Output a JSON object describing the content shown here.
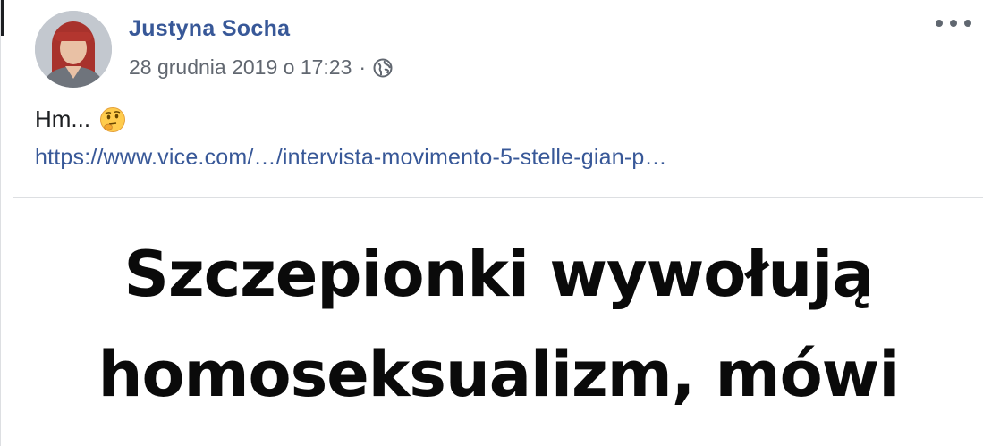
{
  "post": {
    "author": "Justyna Socha",
    "timestamp": "28 grudnia 2019 o 17:23",
    "separator": "·",
    "privacy_icon": "globe-icon",
    "more_icon": "more-options-icon",
    "text": "Hm...",
    "emoji": "thinking-face-emoji",
    "link_text": "https://www.vice.com/…/intervista-movimento-5-stelle-gian-p…"
  },
  "preview": {
    "headline_line1": "Szczepionki wywołują",
    "headline_line2": "homoseksualizm, mówi"
  },
  "colors": {
    "author": "#385898",
    "link": "#385898",
    "meta": "#616770",
    "text": "#1c1e21",
    "headline": "#0a0a0a"
  }
}
